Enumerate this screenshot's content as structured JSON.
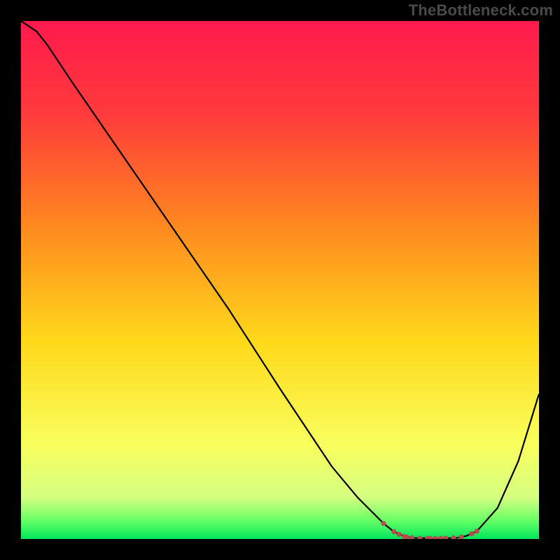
{
  "watermark": "TheBottleneck.com",
  "chart_data": {
    "type": "line",
    "title": "",
    "xlabel": "",
    "ylabel": "",
    "xlim": [
      0,
      100
    ],
    "ylim": [
      0,
      100
    ],
    "series": [
      {
        "name": "curve",
        "x": [
          0,
          3,
          5,
          10,
          20,
          30,
          40,
          50,
          55,
          60,
          65,
          70,
          72,
          74,
          76,
          80,
          84,
          86,
          88,
          92,
          96,
          100
        ],
        "y": [
          100,
          98,
          95.5,
          88,
          73.5,
          59,
          44.5,
          29,
          21.5,
          14,
          8,
          3,
          1.4,
          0.5,
          0.2,
          0.1,
          0.2,
          0.6,
          1.5,
          6,
          15,
          28
        ],
        "color": "#000000"
      },
      {
        "name": "optimal-zone",
        "x": [
          70,
          72,
          73,
          74,
          74.5,
          75.5,
          77,
          78.5,
          79,
          80,
          81,
          82,
          83.5,
          85,
          87,
          88
        ],
        "y": [
          3,
          1.4,
          0.9,
          0.5,
          0.35,
          0.22,
          0.12,
          0.1,
          0.1,
          0.1,
          0.12,
          0.15,
          0.22,
          0.35,
          1,
          1.5
        ],
        "color": "#b84d4d"
      }
    ],
    "gradient_stops": [
      {
        "offset": 0.0,
        "color": "#ff1a4d"
      },
      {
        "offset": 0.18,
        "color": "#ff3b3b"
      },
      {
        "offset": 0.4,
        "color": "#ff8a1f"
      },
      {
        "offset": 0.62,
        "color": "#ffd91a"
      },
      {
        "offset": 0.82,
        "color": "#f8ff5e"
      },
      {
        "offset": 0.92,
        "color": "#d5ff80"
      },
      {
        "offset": 0.965,
        "color": "#66ff66"
      },
      {
        "offset": 1.0,
        "color": "#00e65c"
      }
    ]
  }
}
